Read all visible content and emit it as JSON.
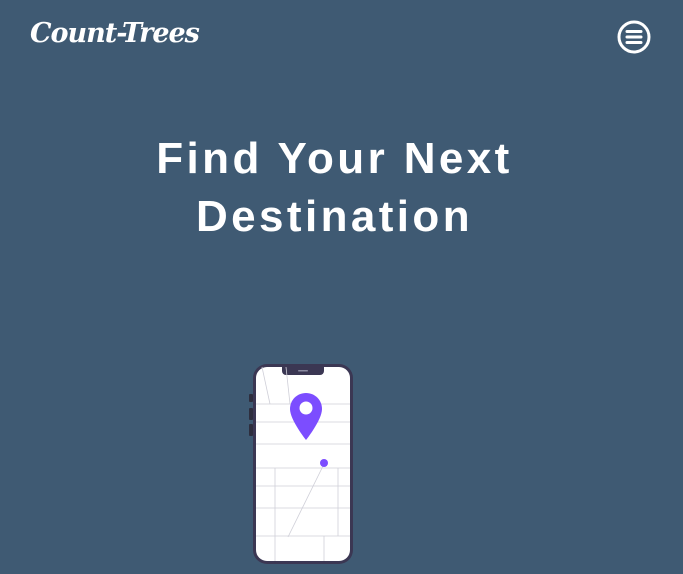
{
  "header": {
    "logo_text": "Count-Trees",
    "menu_icon": "hamburger-menu-circle-icon"
  },
  "hero": {
    "title_line1": "Find Your Next",
    "title_line2": "Destination"
  },
  "illustration": {
    "device_icon": "smartphone-icon",
    "marker_icon": "map-pin-icon",
    "marker_color": "#7c4dff",
    "background_color": "#3f5a73"
  }
}
